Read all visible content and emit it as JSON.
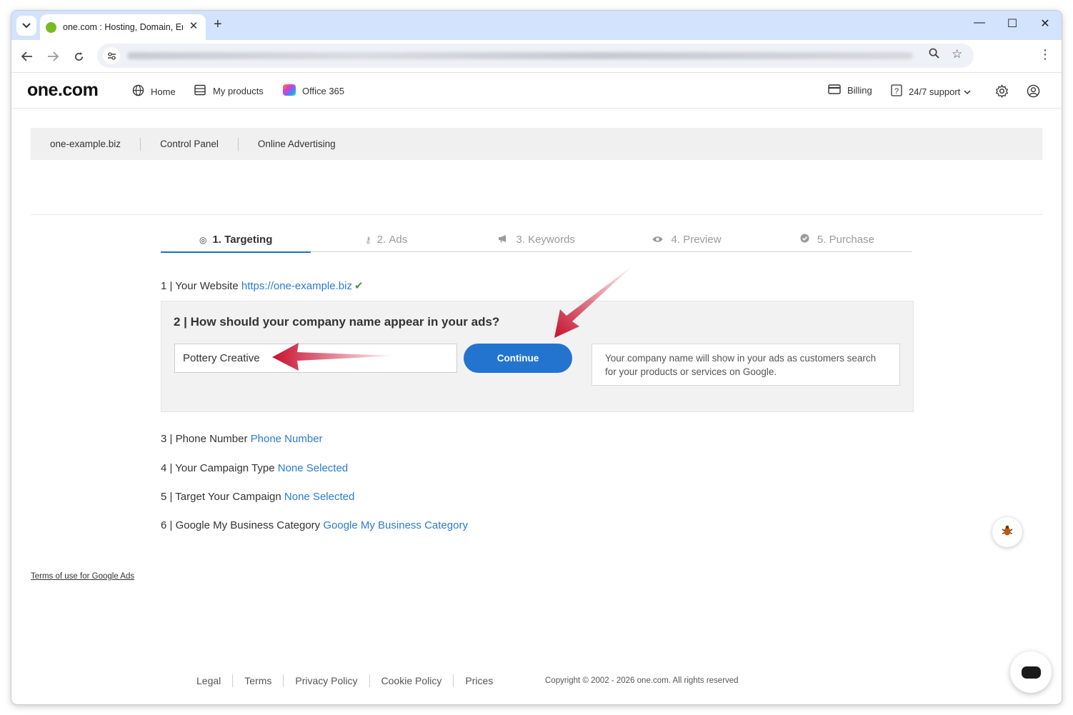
{
  "browser": {
    "tab_title": "one.com : Hosting, Domain, Email",
    "tab_close": "✕",
    "new_tab": "+",
    "minimize": "—",
    "maximize": "☐",
    "close": "✕"
  },
  "header": {
    "logo": "one.com",
    "nav": [
      {
        "label": "Home",
        "icon": "globe-icon"
      },
      {
        "label": "My products",
        "icon": "list-icon"
      },
      {
        "label": "Office 365",
        "icon": "office365-icon"
      }
    ],
    "billing": "Billing",
    "support": "24/7 support"
  },
  "breadcrumbs": [
    "one-example.biz",
    "Control Panel",
    "Online Advertising"
  ],
  "steps": [
    {
      "num": "1.",
      "label": "Targeting",
      "icon": "target-icon",
      "active": true
    },
    {
      "num": "2.",
      "label": "Ads",
      "icon": "key-icon",
      "active": false
    },
    {
      "num": "3.",
      "label": "Keywords",
      "icon": "megaphone-icon",
      "active": false
    },
    {
      "num": "4.",
      "label": "Preview",
      "icon": "eye-icon",
      "active": false
    },
    {
      "num": "5.",
      "label": "Purchase",
      "icon": "check-circle-icon",
      "active": false
    }
  ],
  "form": {
    "website": {
      "prefix": "1 | Your Website ",
      "value": "https://one-example.biz"
    },
    "company": {
      "question": "2 | How should your company name appear in your ads?",
      "value": "Pottery Creative",
      "button": "Continue",
      "hint": "Your company name will show in your ads as customers search for your products or services on Google."
    },
    "phone": {
      "prefix": "3 | Phone Number ",
      "value": "Phone Number"
    },
    "campaign_type": {
      "prefix": "4 | Your Campaign Type ",
      "value": "None Selected"
    },
    "target": {
      "prefix": "5 | Target Your Campaign ",
      "value": "None Selected"
    },
    "gmb": {
      "prefix": "6 | Google My Business Category ",
      "value": "Google My Business Category"
    }
  },
  "terms_link": "Terms of use for Google Ads",
  "footer": {
    "links": [
      "Legal",
      "Terms",
      "Privacy Policy",
      "Cookie Policy",
      "Prices"
    ],
    "copyright": "Copyright © 2002 - 2026 one.com. All rights reserved"
  },
  "colors": {
    "accent": "#2374cf",
    "link": "#2b7bcf",
    "brand_green": "#76bc21",
    "annotation_arrow": "#d0142c"
  }
}
